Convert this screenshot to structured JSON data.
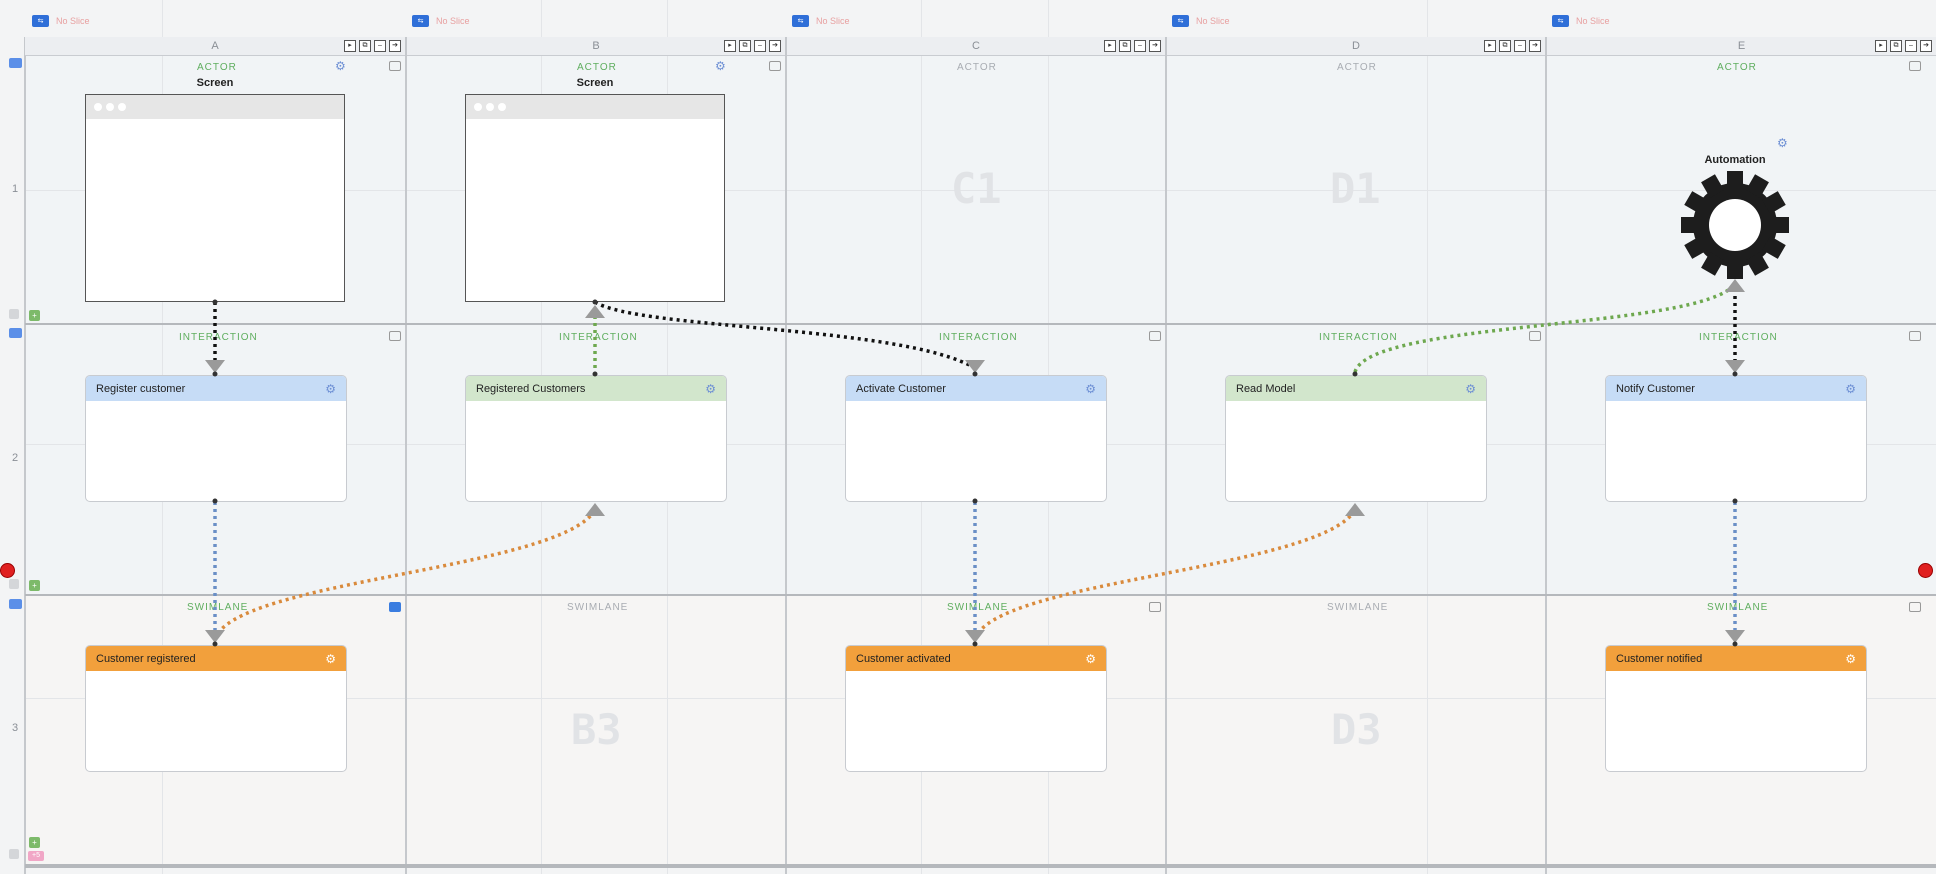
{
  "slices": [
    {
      "label": "No Slice"
    },
    {
      "label": "No Slice"
    },
    {
      "label": "No Slice"
    },
    {
      "label": "No Slice"
    },
    {
      "label": "No Slice"
    }
  ],
  "columns": [
    {
      "letter": "A"
    },
    {
      "letter": "B"
    },
    {
      "letter": "C"
    },
    {
      "letter": "D"
    },
    {
      "letter": "E"
    }
  ],
  "column_tools": [
    "▸",
    "⧉",
    "–",
    "➔"
  ],
  "rows": [
    {
      "number": "1",
      "lane_labels": [
        "ACTOR",
        "ACTOR",
        "ACTOR",
        "ACTOR",
        "ACTOR"
      ]
    },
    {
      "number": "2",
      "lane_labels": [
        "INTERACTION",
        "INTERACTION",
        "INTERACTION",
        "INTERACTION",
        "INTERACTION"
      ]
    },
    {
      "number": "3",
      "lane_labels": [
        "SWIMLANE",
        "SWIMLANE",
        "SWIMLANE",
        "SWIMLANE",
        "SWIMLANE"
      ]
    }
  ],
  "watermarks": {
    "c1": "C1",
    "d1": "D1",
    "b3": "B3",
    "d3": "D3"
  },
  "screens": [
    {
      "title": "Screen"
    },
    {
      "title": "Screen"
    }
  ],
  "automation": {
    "title": "Automation"
  },
  "commands": [
    {
      "label": "Register customer",
      "color": "#c6dcf6"
    },
    {
      "label": "Activate Customer",
      "color": "#c6dcf6"
    },
    {
      "label": "Notify Customer",
      "color": "#c6dcf6"
    }
  ],
  "read_models": [
    {
      "label": "Registered Customers",
      "color": "#d2e6cc"
    },
    {
      "label": "Read Model",
      "color": "#d2e6cc"
    }
  ],
  "events": [
    {
      "label": "Customer registered",
      "color": "#f2a03c"
    },
    {
      "label": "Customer activated",
      "color": "#f2a03c"
    },
    {
      "label": "Customer notified",
      "color": "#f2a03c"
    }
  ],
  "colors": {
    "actor_label": "#5fae5f",
    "lane_label_muted": "#a8acb2",
    "connector_black": "#111111",
    "connector_green": "#6ea84f",
    "connector_blue": "#6a8fc6",
    "connector_orange": "#d98a3c"
  },
  "icons": {
    "gear": "gear-icon",
    "comment": "comment-icon",
    "add": "plus-icon"
  },
  "minor_badge": "+5",
  "add_glyph": "+"
}
